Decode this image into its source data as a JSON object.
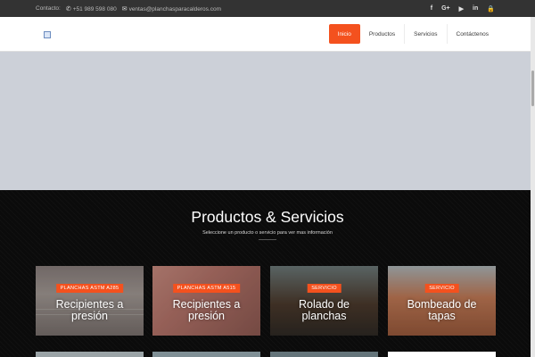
{
  "topbar": {
    "contact_label": "Contacto:",
    "phone": "+51 989 598 080",
    "email": "ventas@planchasparacalderos.com",
    "social": [
      "f",
      "G+",
      "▶",
      "in",
      "🔒"
    ]
  },
  "nav": {
    "items": [
      "Inicio",
      "Productos",
      "Servicios",
      "Contáctenos"
    ],
    "active_color": "#f4511e"
  },
  "section": {
    "title": "Productos & Servicios",
    "subtitle": "Seleccione un producto o servicio para ver mas información"
  },
  "cards": [
    {
      "badge": "PLANCHAS ASTM A285",
      "title_line1": "Recipientes a",
      "title_line2": "presión"
    },
    {
      "badge": "PLANCHAS ASTM A515",
      "title_line1": "Recipientes a",
      "title_line2": "presión"
    },
    {
      "badge": "SERVICIO",
      "title_line1": "Rolado de",
      "title_line2": "planchas"
    },
    {
      "badge": "SERVICIO",
      "title_line1": "Bombeado de",
      "title_line2": "tapas"
    }
  ]
}
